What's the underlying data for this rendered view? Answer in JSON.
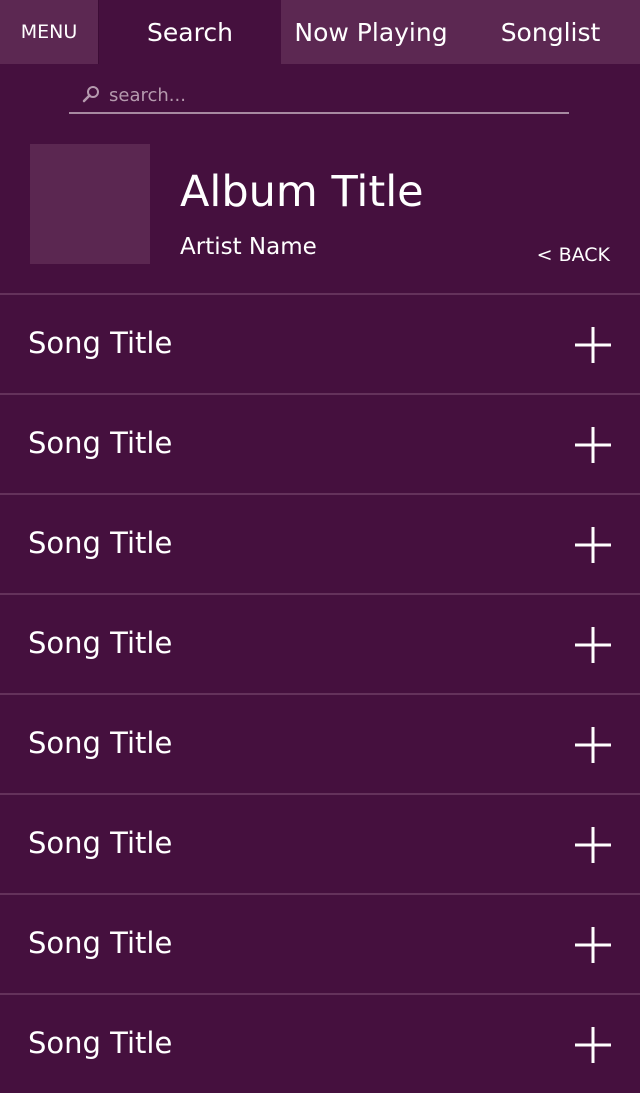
{
  "tabs": {
    "menu": "MENU",
    "search": "Search",
    "now_playing": "Now Playing",
    "songlist": "Songlist"
  },
  "search": {
    "placeholder": "search..."
  },
  "album": {
    "title": "Album Title",
    "artist": "Artist Name",
    "back_label": "< BACK"
  },
  "songs": [
    {
      "title": "Song Title"
    },
    {
      "title": "Song Title"
    },
    {
      "title": "Song Title"
    },
    {
      "title": "Song Title"
    },
    {
      "title": "Song Title"
    },
    {
      "title": "Song Title"
    },
    {
      "title": "Song Title"
    },
    {
      "title": "Song Title"
    }
  ],
  "colors": {
    "background": "#45103e",
    "tab_inactive": "#5c2852",
    "divider": "#64325b",
    "album_art": "#5b2751",
    "text": "#ffffff"
  },
  "icons": {
    "search": "search-icon",
    "add": "plus-icon"
  }
}
